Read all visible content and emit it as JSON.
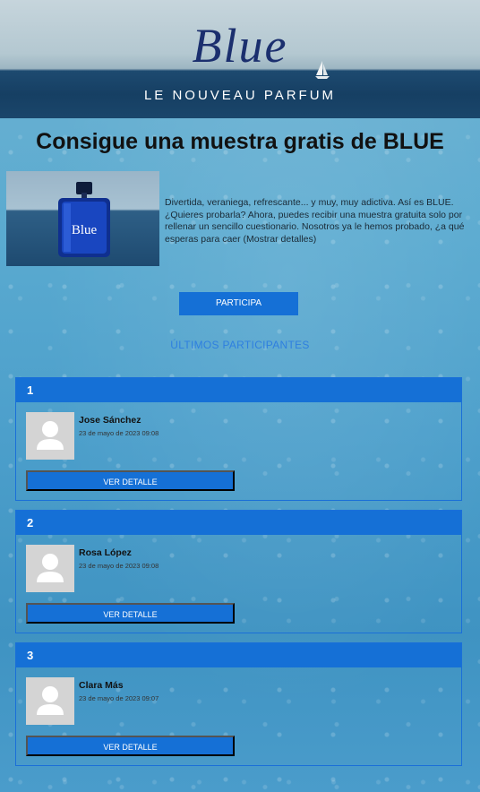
{
  "hero": {
    "title": "Blue",
    "subtitle": "LE NOUVEAU PARFUM"
  },
  "headline": "Consigue una muestra gratis de BLUE",
  "product": {
    "label": "Blue",
    "description": "Divertida, veraniega, refrescante... y muy, muy adictiva. Así es BLUE. ¿Quieres probarla? Ahora, puedes recibir una muestra gratuita solo por rellenar un sencillo cuestionario. Nosotros ya le hemos probado, ¿a qué esperas para caer (Mostrar detalles)"
  },
  "cta_label": "PARTICIPA",
  "last_participants_label": "ÚLTIMOS PARTICIPANTES",
  "participants": [
    {
      "rank": "1",
      "name": "Jose Sánchez",
      "date": "23 de mayo de 2023 09:08",
      "button": "VER DETALLE"
    },
    {
      "rank": "2",
      "name": "Rosa López",
      "date": "23 de mayo de 2023 09:08",
      "button": "VER DETALLE"
    },
    {
      "rank": "3",
      "name": "Clara Más",
      "date": "23 de mayo de 2023 09:07",
      "button": "VER DETALLE"
    }
  ],
  "colors": {
    "accent": "#1570d6",
    "link": "#2e7fe0",
    "title_blue": "#1b2f6e"
  }
}
